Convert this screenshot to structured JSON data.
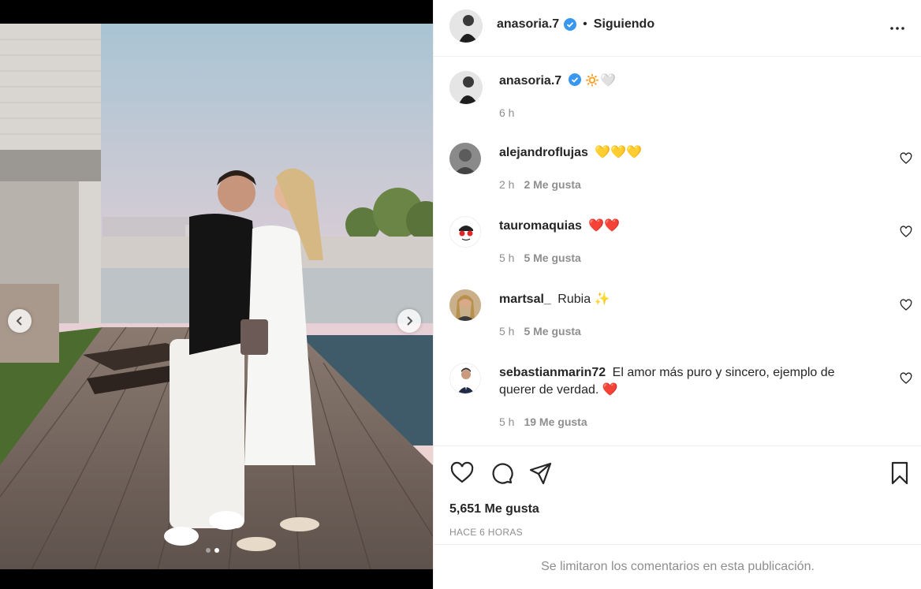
{
  "post": {
    "author": "anasoria.7",
    "follow_status": "Siguiendo",
    "caption_emoji": "🔅🤍",
    "caption_time": "6 h",
    "likes_text": "5,651 Me gusta",
    "time_ago": "HACE 6 HORAS",
    "comments_limited_text": "Se limitaron los comentarios en esta publicación.",
    "carousel": {
      "total": 2,
      "active_index": 2
    }
  },
  "comments": [
    {
      "user": "alejandroflujas",
      "text": "💛💛💛",
      "time": "2 h",
      "likes": "2 Me gusta"
    },
    {
      "user": "tauromaquias",
      "text": "❤️❤️",
      "time": "5 h",
      "likes": "5 Me gusta"
    },
    {
      "user": "martsal_",
      "text": "Rubia ✨",
      "time": "5 h",
      "likes": "5 Me gusta"
    },
    {
      "user": "sebastianmarin72",
      "text": "El amor más puro y sincero, ejemplo de querer de verdad. ❤️",
      "time": "5 h",
      "likes": "19 Me gusta"
    }
  ],
  "colors": {
    "verified": "#3897f0",
    "muted": "#8e8e8e",
    "text": "#262626"
  },
  "icons": [
    "more-options-icon",
    "heart-icon",
    "comment-icon",
    "share-icon",
    "bookmark-icon",
    "chevron-left-icon",
    "chevron-right-icon",
    "verified-badge-icon"
  ]
}
